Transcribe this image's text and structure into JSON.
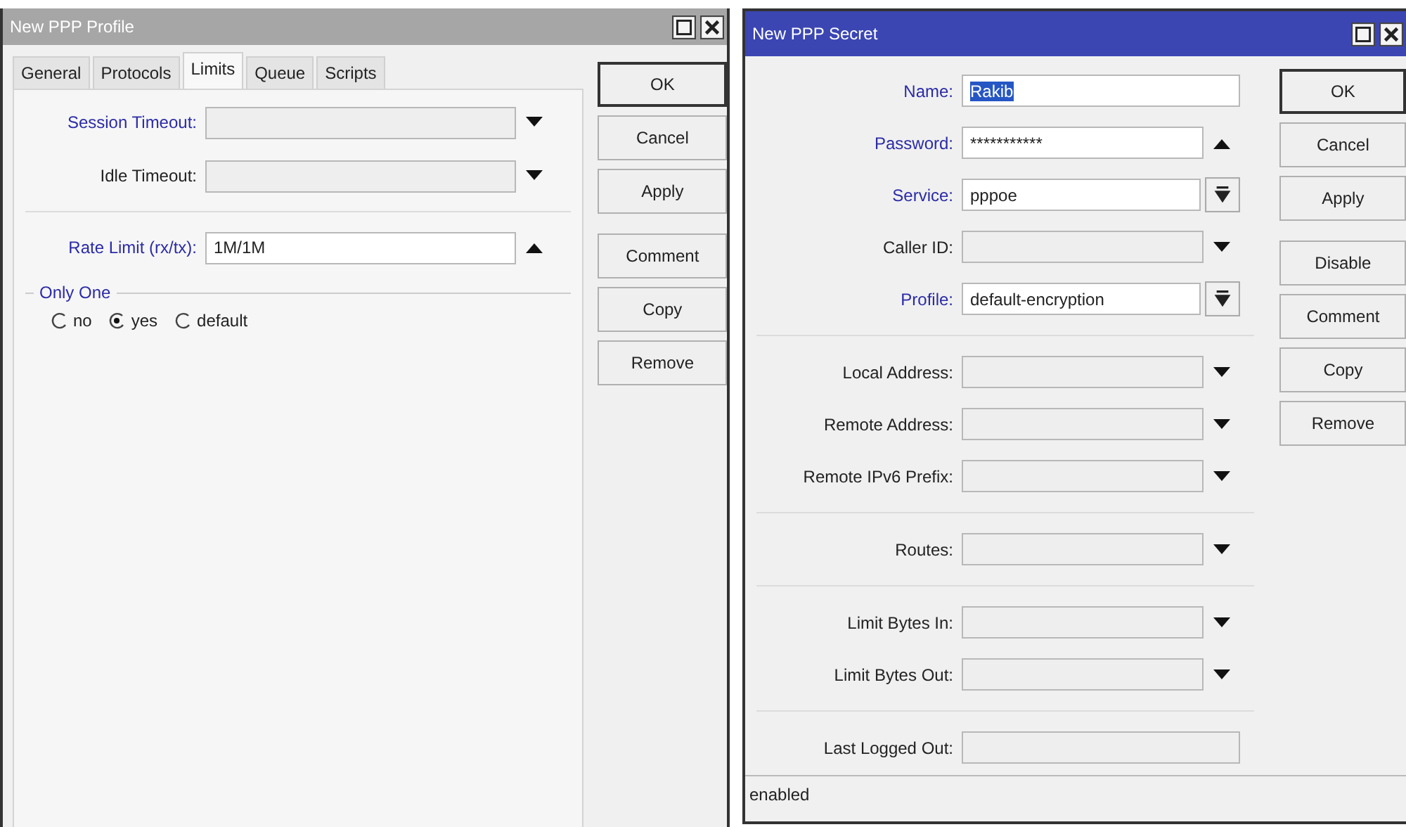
{
  "profile_window": {
    "title": "New PPP Profile",
    "active": false,
    "tabs": [
      {
        "label": "General",
        "selected": false
      },
      {
        "label": "Protocols",
        "selected": false
      },
      {
        "label": "Limits",
        "selected": true
      },
      {
        "label": "Queue",
        "selected": false
      },
      {
        "label": "Scripts",
        "selected": false
      }
    ],
    "sections": [
      [
        {
          "label": "Session Timeout:",
          "kind": "down",
          "modified": true
        },
        {
          "label": "Idle Timeout:",
          "kind": "down",
          "modified": false
        }
      ],
      [
        {
          "label": "Rate Limit (rx/tx):",
          "kind": "up",
          "modified": true,
          "value": "1M/1M"
        }
      ]
    ],
    "group": {
      "title": "Only One",
      "modified": true,
      "options": [
        {
          "label": "no",
          "selected": false
        },
        {
          "label": "yes",
          "selected": true
        },
        {
          "label": "default",
          "selected": false
        }
      ]
    },
    "button_groups": [
      [
        {
          "label": "OK",
          "default": true
        },
        {
          "label": "Cancel",
          "default": false
        },
        {
          "label": "Apply",
          "default": false
        }
      ],
      [
        {
          "label": "Comment",
          "default": false
        },
        {
          "label": "Copy",
          "default": false
        },
        {
          "label": "Remove",
          "default": false
        }
      ]
    ]
  },
  "secret_window": {
    "title": "New PPP Secret",
    "active": true,
    "sections": [
      [
        {
          "label": "Name:",
          "kind": "text",
          "modified": true,
          "value": "Rakib",
          "text_selected": true
        },
        {
          "label": "Password:",
          "kind": "up",
          "modified": true,
          "value": "***********"
        },
        {
          "label": "Service:",
          "kind": "combo",
          "modified": true,
          "value": "pppoe"
        },
        {
          "label": "Caller ID:",
          "kind": "down",
          "modified": false
        },
        {
          "label": "Profile:",
          "kind": "combo",
          "modified": true,
          "value": "default-encryption"
        }
      ],
      [
        {
          "label": "Local Address:",
          "kind": "down",
          "modified": false
        },
        {
          "label": "Remote Address:",
          "kind": "down",
          "modified": false
        },
        {
          "label": "Remote IPv6 Prefix:",
          "kind": "down",
          "modified": false
        }
      ],
      [
        {
          "label": "Routes:",
          "kind": "down",
          "modified": false
        }
      ],
      [
        {
          "label": "Limit Bytes In:",
          "kind": "down",
          "modified": false
        },
        {
          "label": "Limit Bytes Out:",
          "kind": "down",
          "modified": false
        }
      ],
      [
        {
          "label": "Last Logged Out:",
          "kind": "text",
          "modified": false
        }
      ]
    ],
    "button_groups": [
      [
        {
          "label": "OK",
          "default": true
        },
        {
          "label": "Cancel",
          "default": false
        },
        {
          "label": "Apply",
          "default": false
        }
      ],
      [
        {
          "label": "Disable",
          "default": false
        },
        {
          "label": "Comment",
          "default": false
        },
        {
          "label": "Copy",
          "default": false
        },
        {
          "label": "Remove",
          "default": false
        }
      ]
    ],
    "status_bar": "enabled"
  }
}
